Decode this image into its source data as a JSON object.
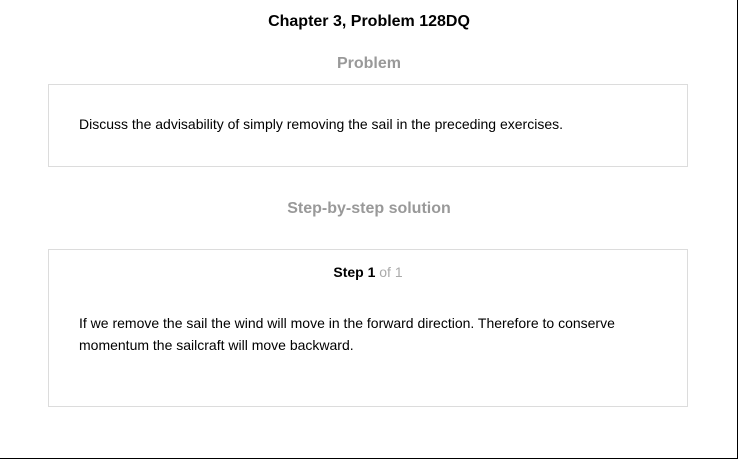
{
  "title": "Chapter 3, Problem 128DQ",
  "problem": {
    "heading": "Problem",
    "text": "Discuss the advisability of simply removing the sail in the preceding exercises."
  },
  "solution": {
    "heading": "Step-by-step solution",
    "step_label": "Step 1",
    "step_of": " of 1",
    "text": "If we remove the sail the wind will move in the forward direction. Therefore to conserve momentum the sailcraft will move backward."
  }
}
